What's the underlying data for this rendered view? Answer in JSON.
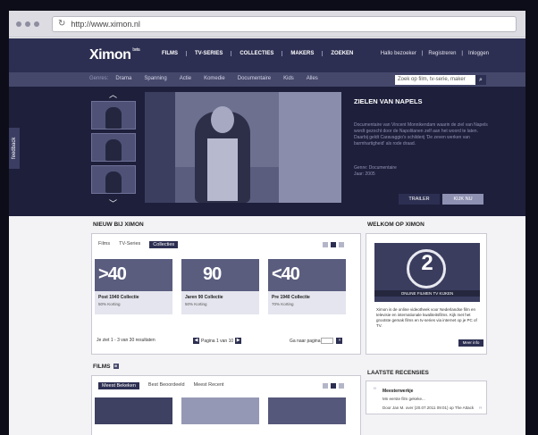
{
  "browser": {
    "url": "http://www.ximon.nl"
  },
  "header": {
    "logo": "Ximon",
    "logo_badge": "beta",
    "nav": [
      "FILMS",
      "TV-SERIES",
      "COLLECTIES",
      "MAKERS",
      "ZOEKEN"
    ],
    "user_links": [
      "Hallo bezoeker",
      "|",
      "Registreren",
      "|",
      "Inloggen"
    ]
  },
  "genre_bar": {
    "label": "Genres:",
    "genres": [
      "Drama",
      "Spanning",
      "Actie",
      "Komedie",
      "Documentaire",
      "Kids",
      "Alles"
    ],
    "search_placeholder": "Zoek op film, tv-serie, maker"
  },
  "feature": {
    "title": "ZIELEN VAN NAPELS",
    "description": "Documentaire van Vincent Monnikendam waarin de ziel van Napels wordt gezocht door de Napolitanen zelf aan het woord te laten. Daarbij geldt Caravaggio's schilderij 'De zeven werken van barmhartigheid' als rode draad.",
    "genre_label": "Genre:",
    "genre": "Documentaire",
    "year_label": "Jaar:",
    "year": "2005",
    "trailer_label": "TRAILER",
    "watch_label": "KIJK NU"
  },
  "feedback_label": "feedback",
  "new": {
    "title": "NIEUW BIJ XIMON",
    "tabs": [
      "Films",
      "TV-Series",
      "Collecties"
    ],
    "cards": [
      {
        "big": ">40",
        "title": "Post 1940 Collectie",
        "sub": "50% Korting"
      },
      {
        "big": "90",
        "title": "Jaren 90 Collectie",
        "sub": "50% Korting"
      },
      {
        "big": "<40",
        "title": "Pre 1940 Collectie",
        "sub": "70% Korting"
      }
    ],
    "results": "Je ziet 1 - 3 van 30 resultaten",
    "page": "Pagina 1 van 10",
    "goto": "Ga naar pagina"
  },
  "welkom": {
    "title": "WELKOM OP XIMON",
    "promo_number": "2",
    "promo_band": "ONLINE FILMEN TV KIJKEN",
    "text": "Ximon is de online videotheek voor Nederlandse film en televisie en internationale kwaliteitsfilms. Kijk met het grootste gemak films en tv-series via internet op je PC of TV.",
    "more": "Meer info"
  },
  "films": {
    "title": "FILMS",
    "tabs": [
      "Meest Bekeken",
      "Best Beoordeeld",
      "Meest Recent"
    ]
  },
  "reviews": {
    "title": "LAATSTE RECENSIES",
    "item_title": "Meesterwerkje",
    "item_sub": "Mn eerste film gekeke...",
    "item_by": "Door Jan M. over (20.07.2011 09:01) op The Attack"
  },
  "colors": {
    "brand": "#2d2f52",
    "genre_bar": "#45476b",
    "feature_bg": "#1d1f3b"
  }
}
